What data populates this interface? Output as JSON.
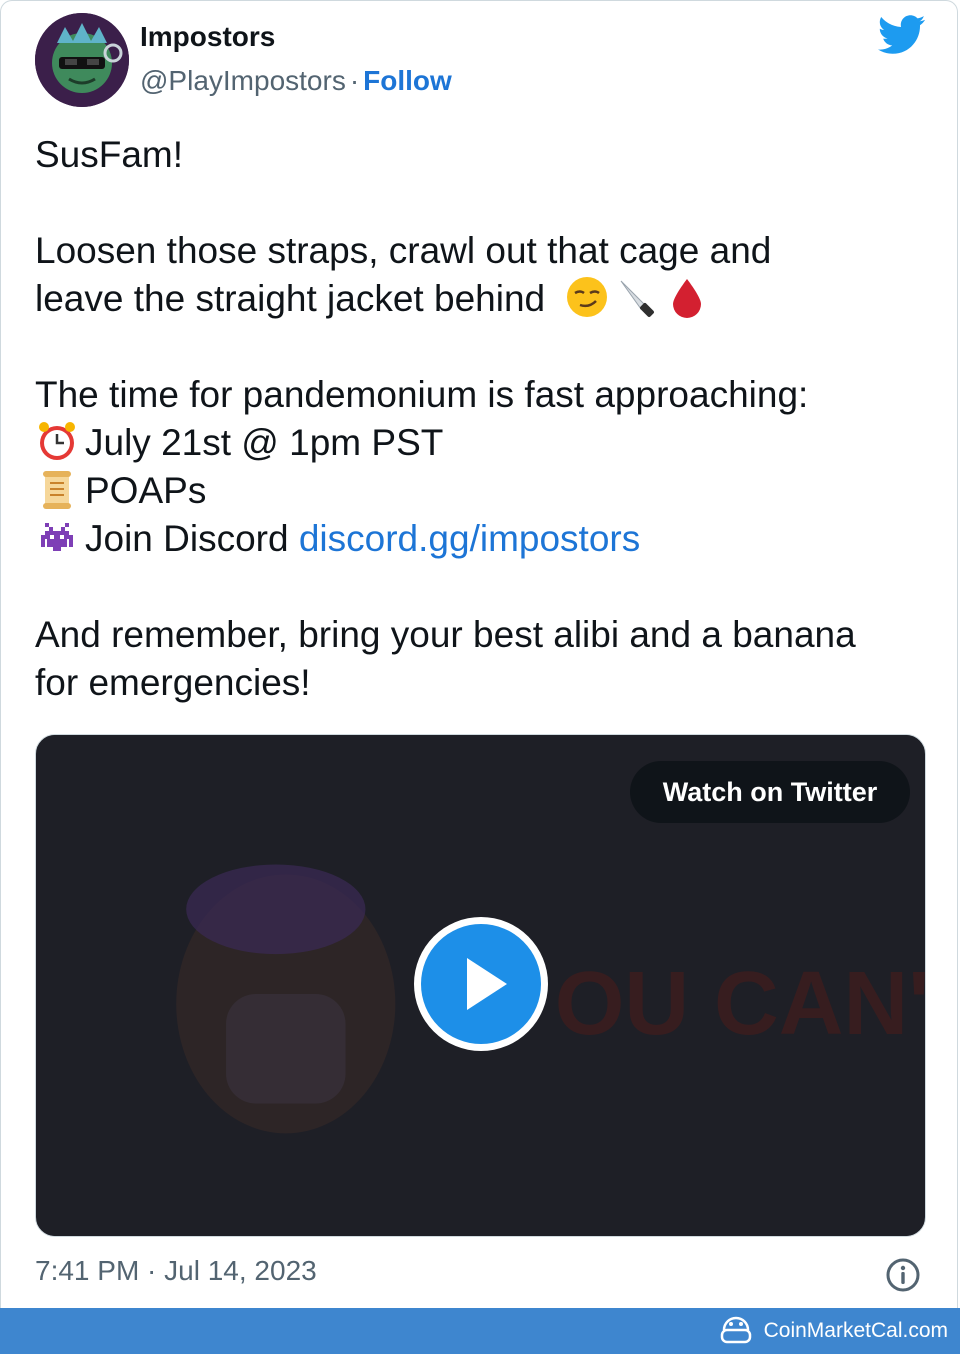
{
  "tweet": {
    "author_name": "Impostors",
    "handle": "@PlayImpostors",
    "separator": "·",
    "follow_label": "Follow",
    "line1": "SusFam!",
    "line2a": "Loosen those straps, crawl out that cage and",
    "line2b": "leave the straight jacket behind",
    "line3": "The time for pandemonium is fast approaching:",
    "item1": "July 21st @ 1pm PST",
    "item2": "POAPs",
    "item3_prefix": "Join Discord ",
    "item3_link": "discord.gg/impostors",
    "line4a": "And remember, bring your best alibi and a banana",
    "line4b": "for emergencies!",
    "timestamp": "7:41 PM · Jul 14, 2023"
  },
  "media": {
    "watch_label": "Watch on Twitter",
    "background_text": "OU CAN'T"
  },
  "footer": {
    "brand": "CoinMarketCal.com"
  },
  "icons": {
    "bird": "twitter-bird-icon",
    "info": "info-icon",
    "play": "play-icon",
    "emojis": [
      "smirk-emoji",
      "knife-emoji",
      "blood-drop-emoji",
      "alarm-clock-emoji",
      "scroll-emoji",
      "space-invader-emoji"
    ]
  },
  "colors": {
    "link": "#1d75d6",
    "secondary_text": "#536471",
    "play_button": "#1d8fe8",
    "footer_bar": "#3e86cf"
  }
}
